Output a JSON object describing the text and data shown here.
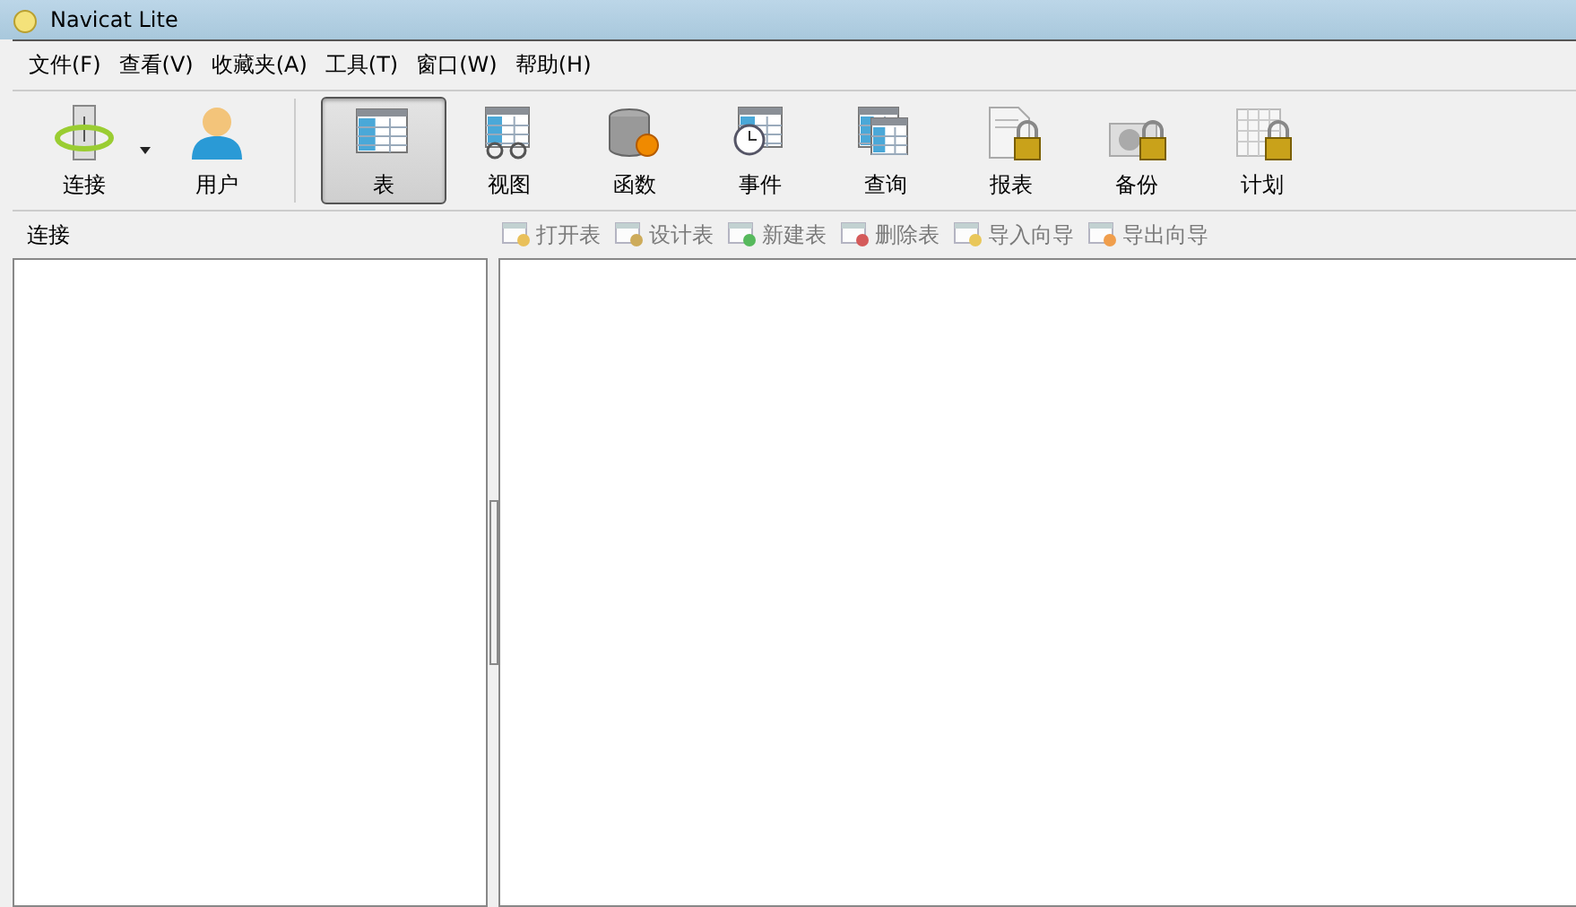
{
  "window": {
    "title": "Navicat Lite"
  },
  "menu": [
    "文件(F)",
    "查看(V)",
    "收藏夹(A)",
    "工具(T)",
    "窗口(W)",
    "帮助(H)"
  ],
  "toolbar_left": [
    {
      "kind": "connection",
      "label": "连接",
      "dropdown": true
    },
    {
      "kind": "user",
      "label": "用户",
      "dropdown": false
    }
  ],
  "toolbar_objects": [
    {
      "kind": "table",
      "label": "表",
      "selected": true,
      "locked": false
    },
    {
      "kind": "view",
      "label": "视图",
      "selected": false,
      "locked": false
    },
    {
      "kind": "function",
      "label": "函数",
      "selected": false,
      "locked": false
    },
    {
      "kind": "event",
      "label": "事件",
      "selected": false,
      "locked": false
    },
    {
      "kind": "query",
      "label": "查询",
      "selected": false,
      "locked": false
    },
    {
      "kind": "report",
      "label": "报表",
      "selected": false,
      "locked": true
    },
    {
      "kind": "backup",
      "label": "备份",
      "selected": false,
      "locked": true
    },
    {
      "kind": "schedule",
      "label": "计划",
      "selected": false,
      "locked": true
    }
  ],
  "connection_panel": {
    "title": "连接"
  },
  "object_actions": [
    {
      "kind": "open",
      "label": "打开表",
      "disabled": true
    },
    {
      "kind": "design",
      "label": "设计表",
      "disabled": true
    },
    {
      "kind": "new",
      "label": "新建表",
      "disabled": true
    },
    {
      "kind": "delete",
      "label": "删除表",
      "disabled": true
    },
    {
      "kind": "import",
      "label": "导入向导",
      "disabled": true
    },
    {
      "kind": "export",
      "label": "导出向导",
      "disabled": true
    }
  ]
}
